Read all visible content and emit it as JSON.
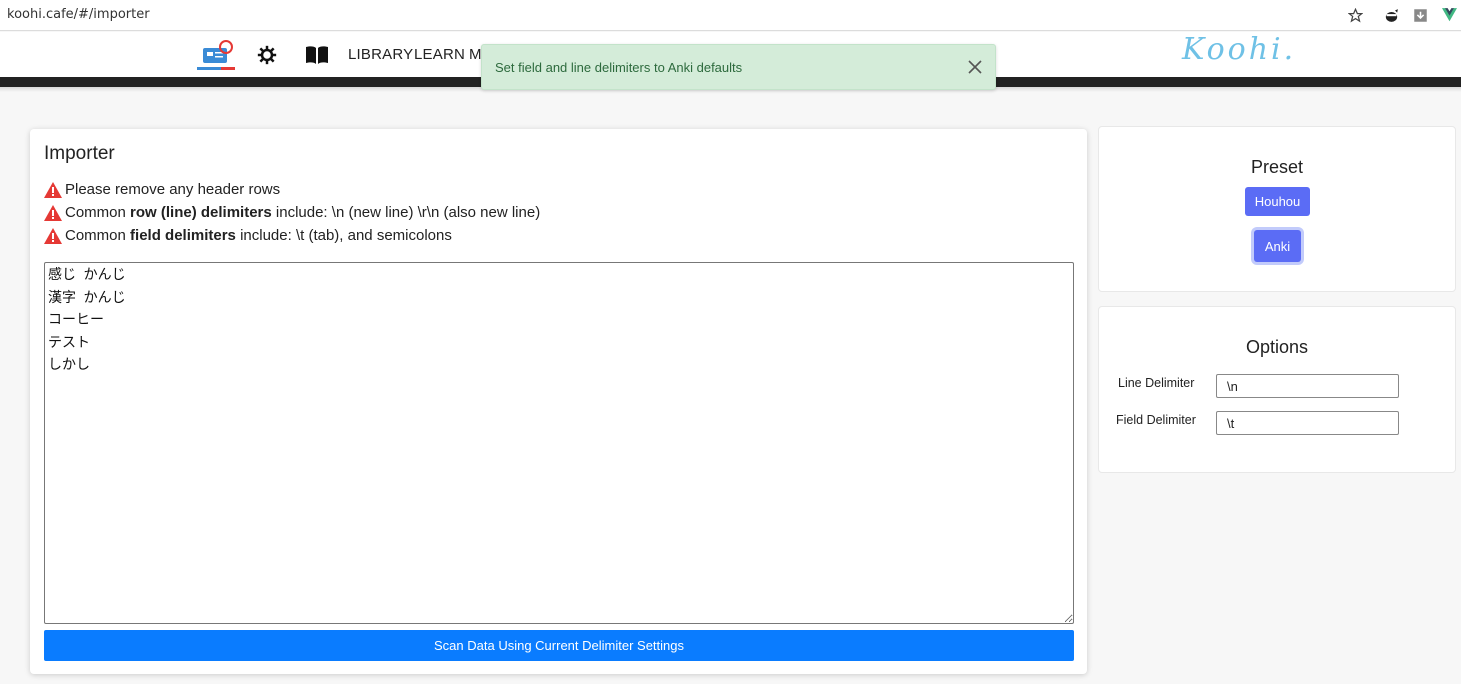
{
  "browser": {
    "url": "koohi.cafe/#/importer",
    "icons": [
      "star-icon",
      "extension-ninja-icon",
      "download-icon",
      "vue-devtools-icon"
    ]
  },
  "nav": {
    "icons": [
      "flashcards-icon",
      "settings-gear-icon",
      "book-icon"
    ],
    "links": [
      "LIBRARY",
      "LEARN",
      "M"
    ],
    "logo": "Koohi."
  },
  "toast": {
    "message": "Set field and line delimiters to Anki defaults"
  },
  "importer": {
    "title": "Importer",
    "notes": [
      {
        "pre": "Please remove any header rows",
        "bold": "",
        "post": ""
      },
      {
        "pre": "Common ",
        "bold": "row (line) delimiters",
        "post": " include: \\n (new line) \\r\\n (also new line)"
      },
      {
        "pre": "Common ",
        "bold": "field delimiters",
        "post": " include: \\t (tab), and semicolons"
      }
    ],
    "text": "感じ\tかんじ\n漢字\tかんじ\nコーヒー\nテスト\nしかし",
    "scan_label": "Scan Data Using Current Delimiter Settings"
  },
  "preset": {
    "title": "Preset",
    "houhou_label": "Houhou",
    "anki_label": "Anki"
  },
  "options": {
    "title": "Options",
    "line_label": "Line Delimiter",
    "line_value": "\\n",
    "field_label": "Field Delimiter",
    "field_value": "\\t"
  },
  "colors": {
    "primary": "#0a7cff",
    "preset_button": "#5b6cf5",
    "toast_bg": "#d4ecd9",
    "warning": "#e53935",
    "logo": "#6fc1e6"
  }
}
